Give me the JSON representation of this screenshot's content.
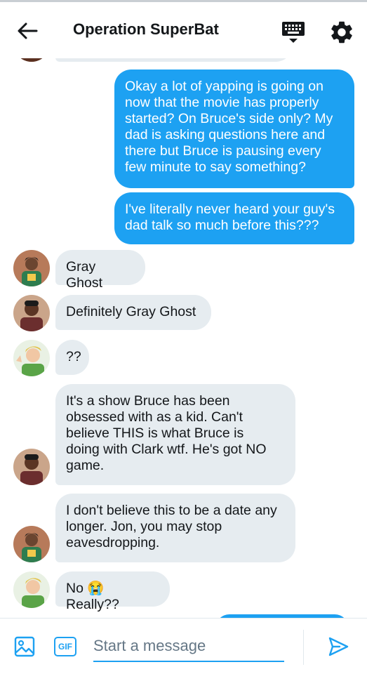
{
  "header": {
    "title": "Operation SuperBat"
  },
  "messages": [
    {
      "type": "sent",
      "text": "Okay a lot of yapping is going on\nnow that the movie has properly\nstarted? On Bruce's side only? My\ndad is asking questions here and\nthere but Bruce is pausing every\nfew minute to say something?"
    },
    {
      "type": "sent",
      "text": "I've literally never heard your guy's\ndad talk so much before this???"
    },
    {
      "type": "received",
      "text": "Gray Ghost"
    },
    {
      "type": "received",
      "text": "Definitely Gray Ghost"
    },
    {
      "type": "received",
      "text": "??"
    },
    {
      "type": "received",
      "text": "It's a show Bruce has been\nobsessed with as a kid. Can't\nbelieve THIS is what Bruce is\ndoing with Clark wtf. He's got NO\ngame."
    },
    {
      "type": "received",
      "text": "I don't believe this to be a date any\nlonger. Jon, you may stop\neavesdropping."
    },
    {
      "type": "received",
      "text": "No 😭 Really??"
    }
  ],
  "composer": {
    "placeholder": "Start a message",
    "gif_label": "GIF"
  },
  "colors": {
    "accent": "#1da1f2",
    "received_bubble": "#e6ecf0",
    "text": "#14171a"
  }
}
